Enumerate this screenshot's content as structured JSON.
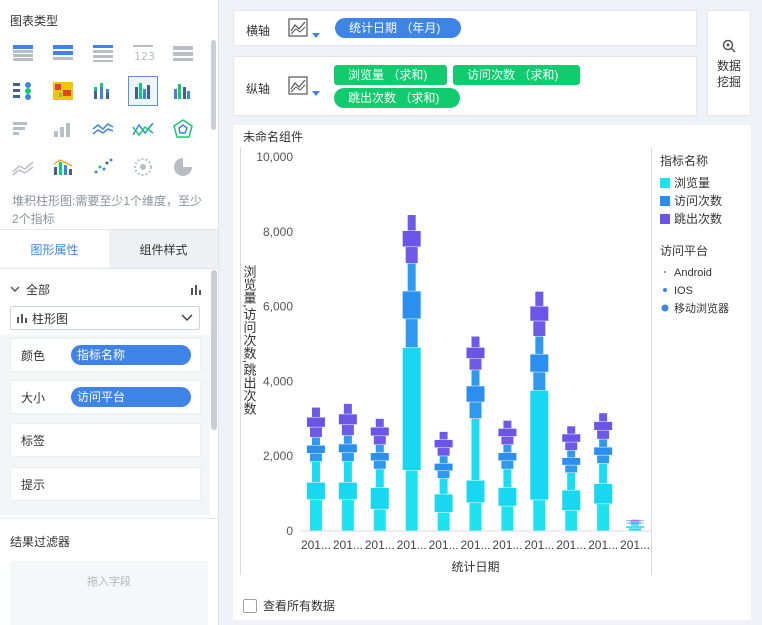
{
  "left_panel": {
    "chart_type_title": "图表类型",
    "chart_type_hint": "堆积柱形图:需要至少1个维度，至少2个指标",
    "chart_type_icons": [
      "cross-table-icon",
      "group-table-icon",
      "detail-table-icon",
      "kpi-number-icon",
      "list-table-icon",
      "gantt-icon",
      "heatmap-icon",
      "stacked-column-icon",
      "multi-series-column-icon",
      "column-icon",
      "bar-icon",
      "stacked-bar-icon",
      "line-icon",
      "radar-line-icon",
      "radar-icon",
      "area-icon",
      "column-line-icon",
      "scatter-icon",
      "bubble-icon",
      "pie-icon"
    ],
    "tabs": {
      "graph_props": "图形属性",
      "component_style": "组件样式"
    },
    "all_label": "全部",
    "chart_select": "柱形图",
    "props": [
      {
        "label": "颜色",
        "pill": "指标名称"
      },
      {
        "label": "大小",
        "pill": "访问平台"
      },
      {
        "label": "标签"
      },
      {
        "label": "提示"
      }
    ],
    "filter_title": "结果过滤器",
    "drop_placeholder": "拖入字段"
  },
  "axis": {
    "x_label": "横轴",
    "y_label": "纵轴",
    "x_fields": [
      "统计日期 （年月)"
    ],
    "y_fields": [
      "浏览量 （求和)",
      "访问次数 （求和)",
      "跳出次数 （求和)"
    ]
  },
  "mining_button": [
    "数据",
    "挖掘"
  ],
  "widget_title": "未命名组件",
  "show_all_label": "查看所有数据",
  "chart_data": {
    "type": "bar",
    "stacked": true,
    "xlabel": "统计日期",
    "ylabel": "浏览量,访问次数,跳出次数",
    "ylim": [
      0,
      10000
    ],
    "yticks": [
      "0",
      "2,000",
      "4,000",
      "6,000",
      "8,000",
      "10,000"
    ],
    "categories": [
      "201...",
      "201...",
      "201...",
      "201...",
      "201...",
      "201...",
      "201...",
      "201...",
      "201...",
      "201...",
      "201..."
    ],
    "legend_color_title": "指标名称",
    "legend_size_title": "访问平台",
    "size_legend": [
      "Android",
      "IOS",
      "移动浏览器"
    ],
    "series": [
      {
        "name": "浏览量",
        "color": "#1de3f0",
        "values": [
          1850,
          1850,
          1650,
          4900,
          1400,
          3000,
          1650,
          3750,
          1550,
          1800,
          180
        ]
      },
      {
        "name": "访问次数",
        "color": "#2c8cf0",
        "values": [
          650,
          700,
          650,
          2250,
          600,
          1300,
          650,
          1450,
          600,
          650,
          60
        ]
      },
      {
        "name": "跳出次数",
        "color": "#6a55e8",
        "values": [
          800,
          850,
          700,
          1300,
          650,
          900,
          650,
          1200,
          650,
          700,
          60
        ]
      }
    ],
    "platform_stack_bands": {
      "浏览量": [
        [
          0.45,
          0.25,
          0.3
        ],
        [
          0.45,
          0.25,
          0.3
        ],
        [
          0.35,
          0.35,
          0.3
        ],
        [
          0.33,
          0.67,
          0.0
        ],
        [
          0.35,
          0.35,
          0.3
        ],
        [
          0.25,
          0.2,
          0.55
        ],
        [
          0.4,
          0.3,
          0.3
        ],
        [
          0.22,
          0.78,
          0.0
        ],
        [
          0.35,
          0.35,
          0.3
        ],
        [
          0.4,
          0.3,
          0.3
        ],
        [
          0.4,
          0.3,
          0.3
        ]
      ]
    }
  }
}
